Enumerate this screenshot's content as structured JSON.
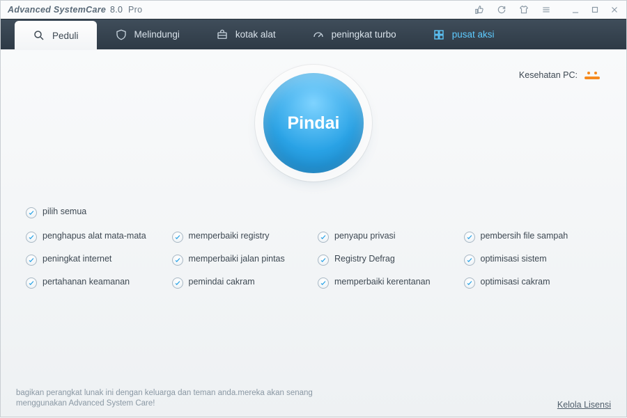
{
  "title": {
    "name": "Advanced SystemCare",
    "version": "8.0",
    "edition": "Pro"
  },
  "tabs": {
    "care": "Peduli",
    "protect": "Melindungi",
    "toolbox": "kotak alat",
    "turbo": "peningkat turbo",
    "action": "pusat aksi"
  },
  "pc_health": {
    "label": "Kesehatan PC:"
  },
  "scan": {
    "label": "Pindai"
  },
  "select_all": "pilih semua",
  "options": {
    "spyware": "penghapus alat mata-mata",
    "registry_fix": "memperbaiki registry",
    "privacy": "penyapu privasi",
    "junk": "pembersih file sampah",
    "internet": "peningkat internet",
    "shortcut": "memperbaiki jalan pintas",
    "registry_defrag": "Registry Defrag",
    "sys_opt": "optimisasi sistem",
    "security": "pertahanan keamanan",
    "disk_scan": "pemindai cakram",
    "vuln": "memperbaiki kerentanan",
    "disk_opt": "optimisasi cakram"
  },
  "footer": {
    "share": "bagikan perangkat lunak ini dengan keluarga dan teman anda.mereka akan senang menggunakan Advanced System Care!",
    "license": "Kelola Lisensi"
  }
}
